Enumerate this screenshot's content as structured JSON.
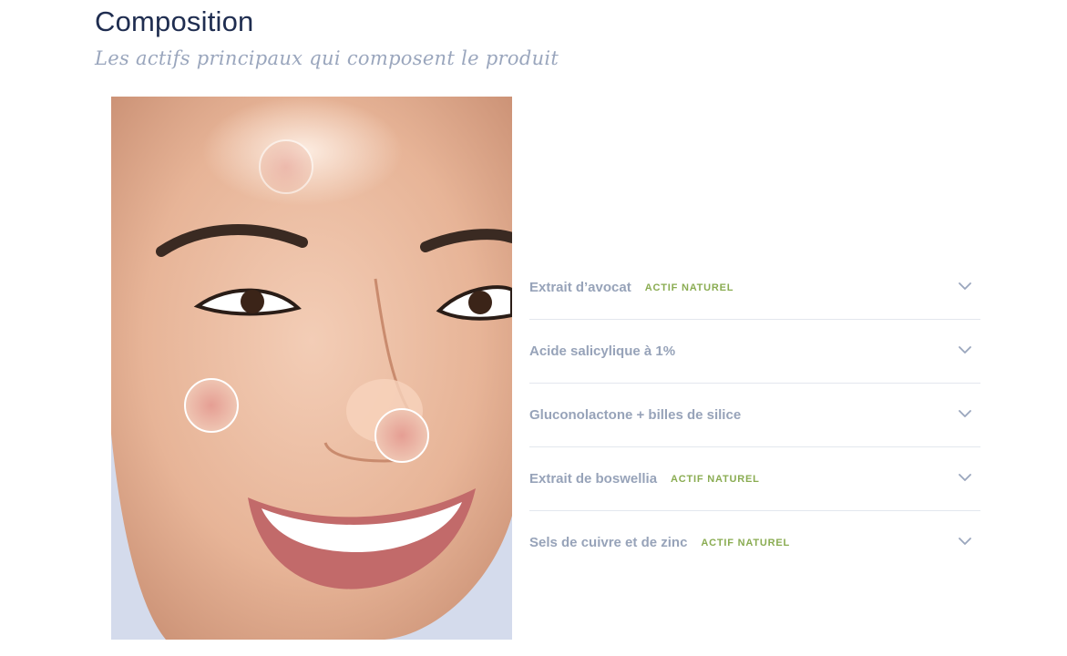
{
  "section": {
    "title": "Composition",
    "subtitle": "Les actifs principaux qui composent le produit"
  },
  "colors": {
    "title": "#1f2d50",
    "subtitle": "#9aa6bd",
    "label": "#97a3b9",
    "badge": "#8aac52",
    "divider": "#e3e7ee"
  },
  "image": {
    "icon": "face-skin-photo"
  },
  "accordion": {
    "items": [
      {
        "label": "Extrait d’avocat",
        "badge": "ACTIF NATUREL"
      },
      {
        "label": "Acide salicylique à 1%",
        "badge": ""
      },
      {
        "label": "Gluconolactone + billes de silice",
        "badge": ""
      },
      {
        "label": "Extrait de boswellia",
        "badge": "ACTIF NATUREL"
      },
      {
        "label": "Sels de cuivre et de zinc",
        "badge": "ACTIF NATUREL"
      }
    ]
  }
}
